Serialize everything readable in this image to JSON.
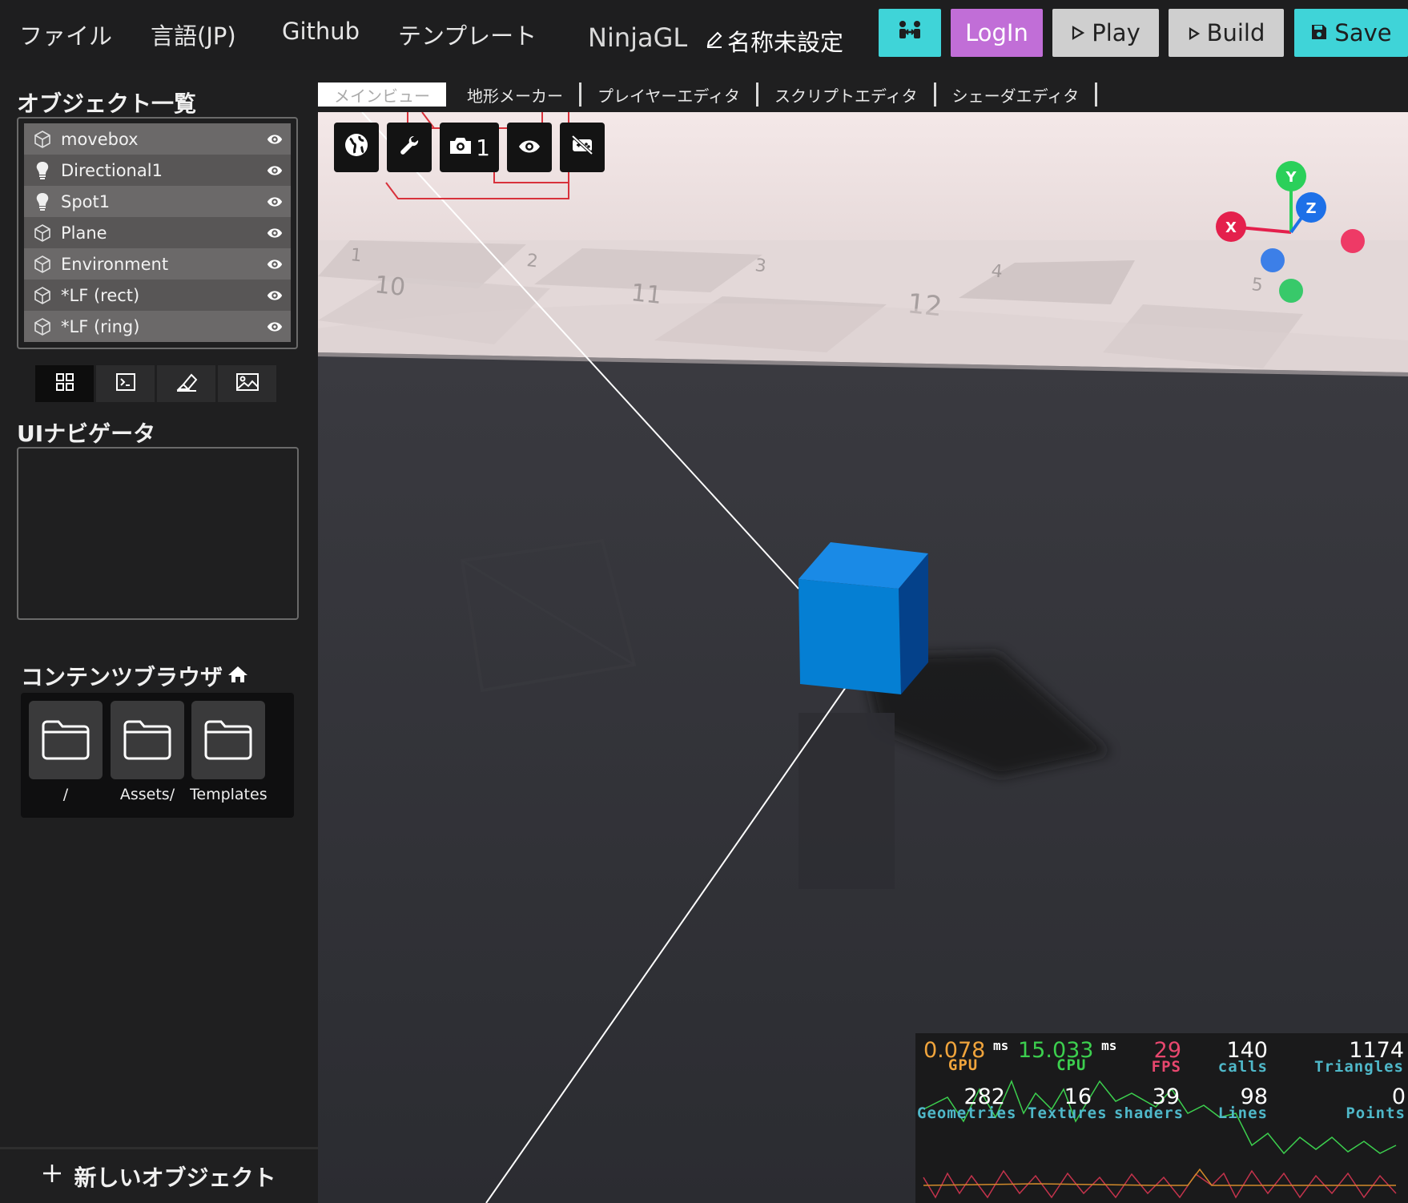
{
  "menu": {
    "file": "ファイル",
    "language": "言語(JP)",
    "github": "Github",
    "template": "テンプレート"
  },
  "app_title": "NinjaGL",
  "project_name": "名称未設定",
  "header_buttons": {
    "login": "LogIn",
    "play": "Play",
    "build": "Build",
    "save": "Save"
  },
  "object_list": {
    "title": "オブジェクト一覧",
    "items": [
      {
        "label": "movebox",
        "icon": "cube-icon"
      },
      {
        "label": "Directional1",
        "icon": "lightbulb-icon"
      },
      {
        "label": "Spot1",
        "icon": "lightbulb-icon"
      },
      {
        "label": "Plane",
        "icon": "cube-icon"
      },
      {
        "label": "Environment",
        "icon": "cube-icon"
      },
      {
        "label": "*LF (rect)",
        "icon": "cube-icon"
      },
      {
        "label": "*LF (ring)",
        "icon": "cube-icon"
      }
    ]
  },
  "ui_navigator": {
    "title": "UIナビゲータ"
  },
  "content_browser": {
    "title": "コンテンツブラウザ",
    "folders": [
      "/",
      "Assets/",
      "Templates/"
    ]
  },
  "new_object": "新しいオブジェクト",
  "editor_tabs": [
    "メインビュー",
    "地形メーカー",
    "プレイヤーエディタ",
    "スクリプトエディタ",
    "シェーダエディタ"
  ],
  "viewport": {
    "camera_label": "1",
    "grid_numbers": [
      "1",
      "2",
      "3",
      "4",
      "10",
      "11",
      "12",
      "5"
    ],
    "gizmo": {
      "x": "X",
      "y": "Y",
      "z": "Z"
    }
  },
  "stats": {
    "gpu": {
      "value": "0.078",
      "unit": "ms",
      "label": "GPU"
    },
    "cpu": {
      "value": "15.033",
      "unit": "ms",
      "label": "CPU"
    },
    "fps": {
      "value": "29",
      "label": "FPS"
    },
    "calls": {
      "value": "140",
      "label": "calls"
    },
    "triangles": {
      "value": "1174",
      "label": "Triangles"
    },
    "geometries": {
      "value": "282",
      "label": "Geometries"
    },
    "textures": {
      "value": "16",
      "label": "Textures"
    },
    "shaders": {
      "value": "39",
      "label": "shaders"
    },
    "lines": {
      "value": "98",
      "label": "Lines"
    },
    "points": {
      "value": "0",
      "label": "Points"
    }
  },
  "colors": {
    "accent_cyan": "#3fd4d8",
    "accent_purple": "#c16ed7",
    "cube_blue": "#0a7fd6",
    "gpu_orange": "#f0a43c",
    "cpu_green": "#3ccf4e",
    "fps_pink": "#e8476e",
    "stat_teal": "#4fb8c9"
  }
}
